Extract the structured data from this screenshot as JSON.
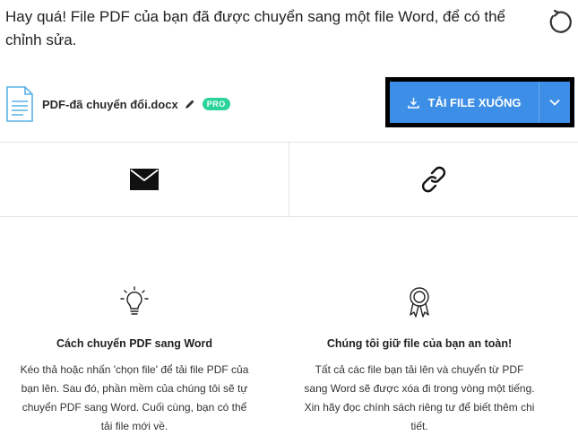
{
  "header": {
    "message": "Hay quá! File PDF của bạn đã được chuyển sang một file Word, để có thể chỉnh sửa.",
    "restart_icon": "restart-icon"
  },
  "file": {
    "name": "PDF-đã chuyển đổi.docx",
    "badge": "PRO",
    "icon": "document-icon",
    "edit_icon": "pencil-icon"
  },
  "download": {
    "label": "TẢI FILE XUỐNG",
    "icon": "download-icon",
    "dropdown_icon": "chevron-down-icon",
    "color": "#3d8ee6"
  },
  "share": [
    {
      "icon": "email-icon"
    },
    {
      "icon": "link-icon"
    }
  ],
  "info": [
    {
      "icon": "lightbulb-icon",
      "title": "Cách chuyển PDF sang Word",
      "text": "Kéo thả hoặc nhấn 'chọn file' để tải file PDF của bạn lên. Sau đó, phần mềm của chúng tôi sẽ tự chuyển PDF sang Word. Cuối cùng, bạn có thể tải file mới về."
    },
    {
      "icon": "award-icon",
      "title": "Chúng tôi giữ file của bạn an toàn!",
      "text": "Tất cả các file bạn tải lên và chuyển từ PDF sang Word sẽ được xóa đi trong vòng một tiếng. Xin hãy đọc chính sách riêng tư để biết thêm chi tiết."
    }
  ]
}
